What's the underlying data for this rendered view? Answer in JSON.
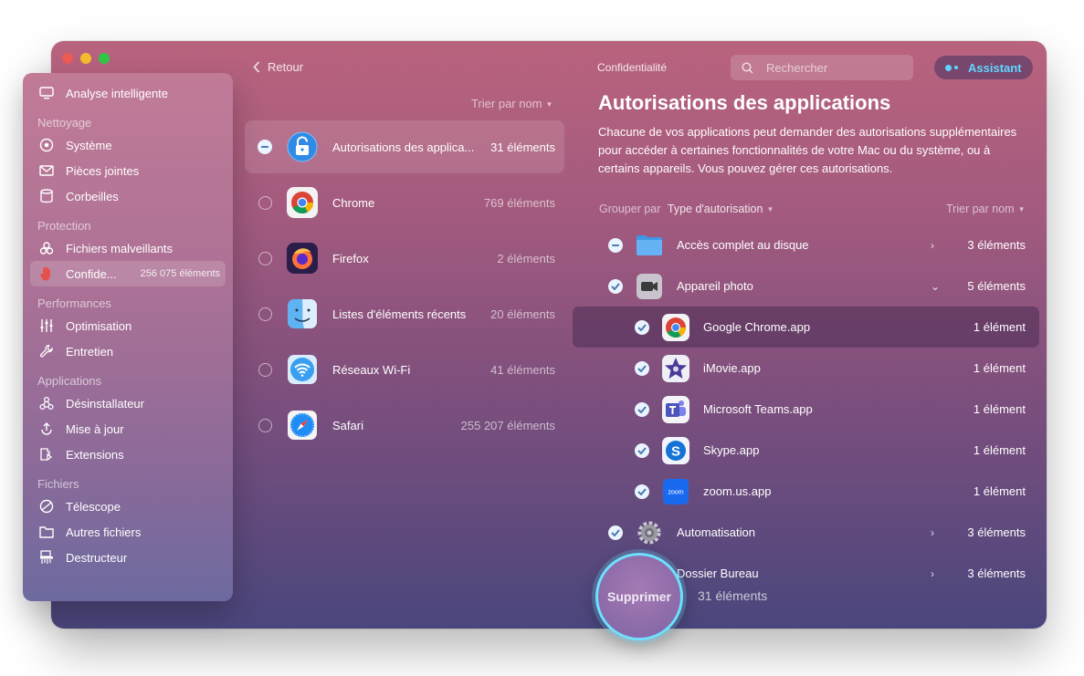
{
  "sidebar": {
    "top_item": "Analyse intelligente",
    "sections": [
      {
        "title": "Nettoyage",
        "items": [
          "Système",
          "Pièces jointes",
          "Corbeilles"
        ]
      },
      {
        "title": "Protection",
        "items": [
          "Fichiers malveillants",
          "Confide..."
        ],
        "active_count": "256 075 éléments"
      },
      {
        "title": "Performances",
        "items": [
          "Optimisation",
          "Entretien"
        ]
      },
      {
        "title": "Applications",
        "items": [
          "Désinstallateur",
          "Mise à jour",
          "Extensions"
        ]
      },
      {
        "title": "Fichiers",
        "items": [
          "Télescope",
          "Autres fichiers",
          "Destructeur"
        ]
      }
    ]
  },
  "middle": {
    "back_label": "Retour",
    "sort_label": "Trier par nom",
    "rows": [
      {
        "name": "Autorisations des applica...",
        "count": "31 éléments",
        "icon": "app-permissions-lock-icon",
        "selected": true
      },
      {
        "name": "Chrome",
        "count": "769 éléments",
        "icon": "chrome-icon"
      },
      {
        "name": "Firefox",
        "count": "2 éléments",
        "icon": "firefox-icon"
      },
      {
        "name": "Listes d'éléments récents",
        "count": "20 éléments",
        "icon": "finder-icon"
      },
      {
        "name": "Réseaux Wi-Fi",
        "count": "41 éléments",
        "icon": "wifi-icon"
      },
      {
        "name": "Safari",
        "count": "255 207 éléments",
        "icon": "safari-icon"
      }
    ]
  },
  "header": {
    "section_title": "Confidentialité",
    "search_placeholder": "Rechercher",
    "assistant_label": "Assistant"
  },
  "right": {
    "title": "Autorisations des applications",
    "description": "Chacune de vos applications peut demander des autorisations supplémentaires pour accéder à certaines fonctionnalités de votre Mac ou du système, ou à certains appareils. Vous pouvez gérer ces autorisations.",
    "group_by_label": "Grouper par",
    "group_by_value": "Type d'autorisation",
    "sort_label": "Trier par nom",
    "rows": [
      {
        "name": "Accès complet au disque",
        "count": "3 éléments",
        "level": 0,
        "state": "partial",
        "expanded": false,
        "icon": "folder-icon"
      },
      {
        "name": "Appareil photo",
        "count": "5 éléments",
        "level": 0,
        "state": "checked",
        "expanded": true,
        "icon": "camera-icon"
      },
      {
        "name": "Google Chrome.app",
        "count": "1 élément",
        "level": 1,
        "state": "checked",
        "icon": "chrome-icon",
        "selected": true
      },
      {
        "name": "iMovie.app",
        "count": "1 élément",
        "level": 1,
        "state": "checked",
        "icon": "imovie-icon"
      },
      {
        "name": "Microsoft Teams.app",
        "count": "1 élément",
        "level": 1,
        "state": "checked",
        "icon": "teams-icon"
      },
      {
        "name": "Skype.app",
        "count": "1 élément",
        "level": 1,
        "state": "checked",
        "icon": "skype-icon"
      },
      {
        "name": "zoom.us.app",
        "count": "1 élément",
        "level": 1,
        "state": "checked",
        "icon": "zoom-icon",
        "icon_text": "zoom"
      },
      {
        "name": "Automatisation",
        "count": "3 éléments",
        "level": 0,
        "state": "checked",
        "expanded": false,
        "icon": "gear-icon"
      },
      {
        "name": "Dossier Bureau",
        "count": "3 éléments",
        "level": 0,
        "state": "checked",
        "expanded": false,
        "icon": "folder-icon"
      }
    ]
  },
  "footer": {
    "delete_label": "Supprimer",
    "delete_count": "31 éléments"
  },
  "colors": {
    "accent_cyan": "#5fd6ff",
    "check_fill": "#e9f4ff",
    "check_mark": "#4d78b2"
  }
}
